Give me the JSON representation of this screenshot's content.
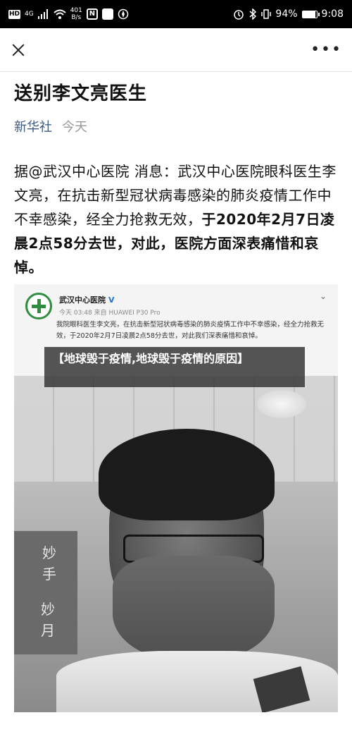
{
  "status_bar": {
    "hd": "HD",
    "network": "4G",
    "speed_value": "401",
    "speed_unit": "B/s",
    "nfc": "N",
    "battery": "94%",
    "battery_level": 0.94,
    "time": "9:08"
  },
  "top_bar": {
    "close_icon": "close-icon",
    "more_label": "•••"
  },
  "article": {
    "title": "送别李文亮医生",
    "source": "新华社",
    "time": "今天",
    "body_plain": "据@武汉中心医院 消息：武汉中心医院眼科医生李文亮，在抗击新型冠状病毒感染的肺炎疫情工作中不幸感染，经全力抢救无效，",
    "body_bold": "于2020年2月7日凌晨2点58分去世，对此，医院方面深表痛惜和哀悼。"
  },
  "embedded_post": {
    "account": "武汉中心医院",
    "verified": "V",
    "time_device": "今天 03:48 来自 HUAWEI P30 Pro",
    "text": "我院眼科医生李文亮，在抗击新型冠状病毒感染的肺炎疫情工作中不幸感染，经全力抢救无效，于2020年2月7日凌晨2点58分去世，对此我们深表痛惜和哀悼。"
  },
  "photo_text": {
    "banner_chars": [
      "妙",
      "手",
      "妙",
      "月"
    ]
  },
  "overlay": {
    "headline": "【地球毁于疫情,地球毁于疫情的原因】"
  }
}
